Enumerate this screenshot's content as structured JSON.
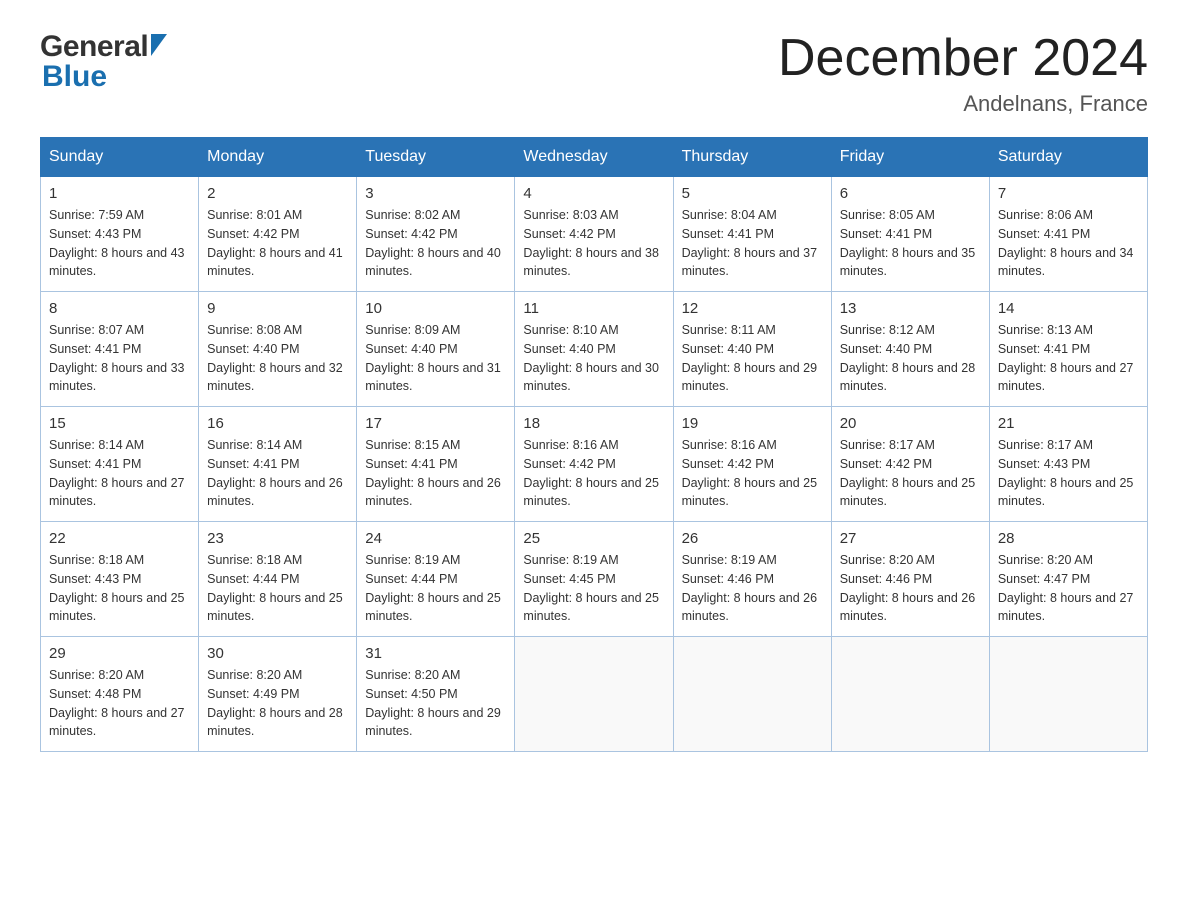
{
  "header": {
    "logo": {
      "general": "General",
      "blue": "Blue"
    },
    "title": "December 2024",
    "location": "Andelnans, France"
  },
  "calendar": {
    "days_of_week": [
      "Sunday",
      "Monday",
      "Tuesday",
      "Wednesday",
      "Thursday",
      "Friday",
      "Saturday"
    ],
    "weeks": [
      [
        {
          "day": "1",
          "sunrise": "7:59 AM",
          "sunset": "4:43 PM",
          "daylight": "8 hours and 43 minutes."
        },
        {
          "day": "2",
          "sunrise": "8:01 AM",
          "sunset": "4:42 PM",
          "daylight": "8 hours and 41 minutes."
        },
        {
          "day": "3",
          "sunrise": "8:02 AM",
          "sunset": "4:42 PM",
          "daylight": "8 hours and 40 minutes."
        },
        {
          "day": "4",
          "sunrise": "8:03 AM",
          "sunset": "4:42 PM",
          "daylight": "8 hours and 38 minutes."
        },
        {
          "day": "5",
          "sunrise": "8:04 AM",
          "sunset": "4:41 PM",
          "daylight": "8 hours and 37 minutes."
        },
        {
          "day": "6",
          "sunrise": "8:05 AM",
          "sunset": "4:41 PM",
          "daylight": "8 hours and 35 minutes."
        },
        {
          "day": "7",
          "sunrise": "8:06 AM",
          "sunset": "4:41 PM",
          "daylight": "8 hours and 34 minutes."
        }
      ],
      [
        {
          "day": "8",
          "sunrise": "8:07 AM",
          "sunset": "4:41 PM",
          "daylight": "8 hours and 33 minutes."
        },
        {
          "day": "9",
          "sunrise": "8:08 AM",
          "sunset": "4:40 PM",
          "daylight": "8 hours and 32 minutes."
        },
        {
          "day": "10",
          "sunrise": "8:09 AM",
          "sunset": "4:40 PM",
          "daylight": "8 hours and 31 minutes."
        },
        {
          "day": "11",
          "sunrise": "8:10 AM",
          "sunset": "4:40 PM",
          "daylight": "8 hours and 30 minutes."
        },
        {
          "day": "12",
          "sunrise": "8:11 AM",
          "sunset": "4:40 PM",
          "daylight": "8 hours and 29 minutes."
        },
        {
          "day": "13",
          "sunrise": "8:12 AM",
          "sunset": "4:40 PM",
          "daylight": "8 hours and 28 minutes."
        },
        {
          "day": "14",
          "sunrise": "8:13 AM",
          "sunset": "4:41 PM",
          "daylight": "8 hours and 27 minutes."
        }
      ],
      [
        {
          "day": "15",
          "sunrise": "8:14 AM",
          "sunset": "4:41 PM",
          "daylight": "8 hours and 27 minutes."
        },
        {
          "day": "16",
          "sunrise": "8:14 AM",
          "sunset": "4:41 PM",
          "daylight": "8 hours and 26 minutes."
        },
        {
          "day": "17",
          "sunrise": "8:15 AM",
          "sunset": "4:41 PM",
          "daylight": "8 hours and 26 minutes."
        },
        {
          "day": "18",
          "sunrise": "8:16 AM",
          "sunset": "4:42 PM",
          "daylight": "8 hours and 25 minutes."
        },
        {
          "day": "19",
          "sunrise": "8:16 AM",
          "sunset": "4:42 PM",
          "daylight": "8 hours and 25 minutes."
        },
        {
          "day": "20",
          "sunrise": "8:17 AM",
          "sunset": "4:42 PM",
          "daylight": "8 hours and 25 minutes."
        },
        {
          "day": "21",
          "sunrise": "8:17 AM",
          "sunset": "4:43 PM",
          "daylight": "8 hours and 25 minutes."
        }
      ],
      [
        {
          "day": "22",
          "sunrise": "8:18 AM",
          "sunset": "4:43 PM",
          "daylight": "8 hours and 25 minutes."
        },
        {
          "day": "23",
          "sunrise": "8:18 AM",
          "sunset": "4:44 PM",
          "daylight": "8 hours and 25 minutes."
        },
        {
          "day": "24",
          "sunrise": "8:19 AM",
          "sunset": "4:44 PM",
          "daylight": "8 hours and 25 minutes."
        },
        {
          "day": "25",
          "sunrise": "8:19 AM",
          "sunset": "4:45 PM",
          "daylight": "8 hours and 25 minutes."
        },
        {
          "day": "26",
          "sunrise": "8:19 AM",
          "sunset": "4:46 PM",
          "daylight": "8 hours and 26 minutes."
        },
        {
          "day": "27",
          "sunrise": "8:20 AM",
          "sunset": "4:46 PM",
          "daylight": "8 hours and 26 minutes."
        },
        {
          "day": "28",
          "sunrise": "8:20 AM",
          "sunset": "4:47 PM",
          "daylight": "8 hours and 27 minutes."
        }
      ],
      [
        {
          "day": "29",
          "sunrise": "8:20 AM",
          "sunset": "4:48 PM",
          "daylight": "8 hours and 27 minutes."
        },
        {
          "day": "30",
          "sunrise": "8:20 AM",
          "sunset": "4:49 PM",
          "daylight": "8 hours and 28 minutes."
        },
        {
          "day": "31",
          "sunrise": "8:20 AM",
          "sunset": "4:50 PM",
          "daylight": "8 hours and 29 minutes."
        },
        null,
        null,
        null,
        null
      ]
    ]
  }
}
